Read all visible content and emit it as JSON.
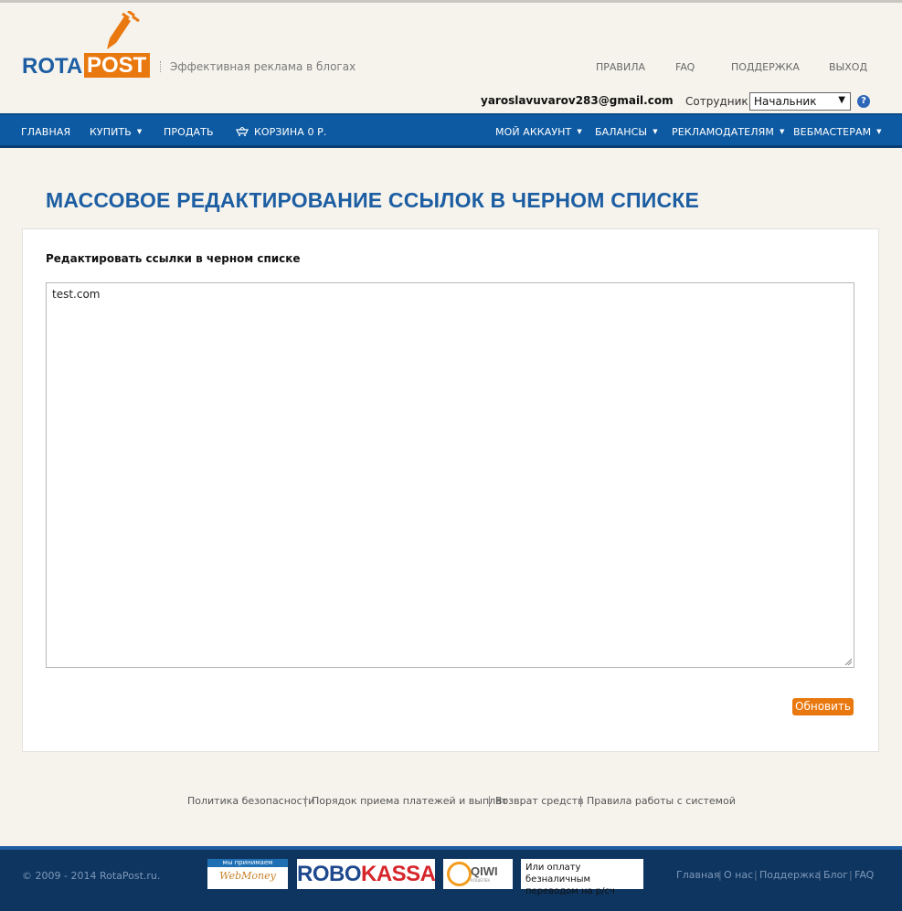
{
  "header": {
    "logo_left": "ROTA",
    "logo_right": "POST",
    "tagline": "Эффективная реклама в блогах",
    "top_links": [
      "ПРАВИЛА",
      "FAQ",
      "ПОДДЕРЖКА",
      "ВЫХОД"
    ],
    "user_email": "yaroslavuvarov283@gmail.com",
    "employee_label": "Сотрудник:",
    "employee_value": "Начальник",
    "help_glyph": "?"
  },
  "nav": {
    "left": [
      {
        "label": "ГЛАВНАЯ",
        "dropdown": false
      },
      {
        "label": "КУПИТЬ",
        "dropdown": true
      },
      {
        "label": "ПРОДАТЬ",
        "dropdown": false
      },
      {
        "label": "КОРЗИНА 0 Р.",
        "dropdown": false,
        "icon": "cart-icon"
      }
    ],
    "right": [
      {
        "label": "МОЙ АККАУНТ",
        "dropdown": true
      },
      {
        "label": "БАЛАНСЫ",
        "dropdown": true
      },
      {
        "label": "РЕКЛАМОДАТЕЛЯМ",
        "dropdown": true
      },
      {
        "label": "ВЕБМАСТЕРАМ",
        "dropdown": true
      }
    ]
  },
  "main": {
    "title": "МАССОВОЕ РЕДАКТИРОВАНИЕ ССЫЛОК В ЧЕРНОМ СПИСКЕ",
    "form_label": "Редактировать ссылки в черном списке",
    "textarea_value": "test.com",
    "submit_label": "Обновить"
  },
  "footer": {
    "links": [
      "Политика безопасности",
      "Порядок приема платежей и выплат",
      "Возврат средств",
      "Правила работы с системой"
    ],
    "copyright": "© 2009 - 2014 RotaPost.ru.",
    "webmoney_top": "мы принимаем",
    "webmoney_main": "WebMoney",
    "robokassa_a": "ROBO",
    "robokassa_b": "KASSA",
    "qiwi": "QIWI",
    "qiwi_sub": "КОШЕЛЕК",
    "bank_text": "Или оплату безналичным переводом на р/сч",
    "bottom_links": [
      "Главная",
      "О нас",
      "Поддержка",
      "Блог",
      "FAQ"
    ]
  },
  "colors": {
    "brand_blue": "#1d5ea3",
    "nav_blue": "#0d5aa2",
    "accent_orange": "#e9780f",
    "footer_navy": "#0e3560",
    "page_bg": "#f5f3ec"
  }
}
